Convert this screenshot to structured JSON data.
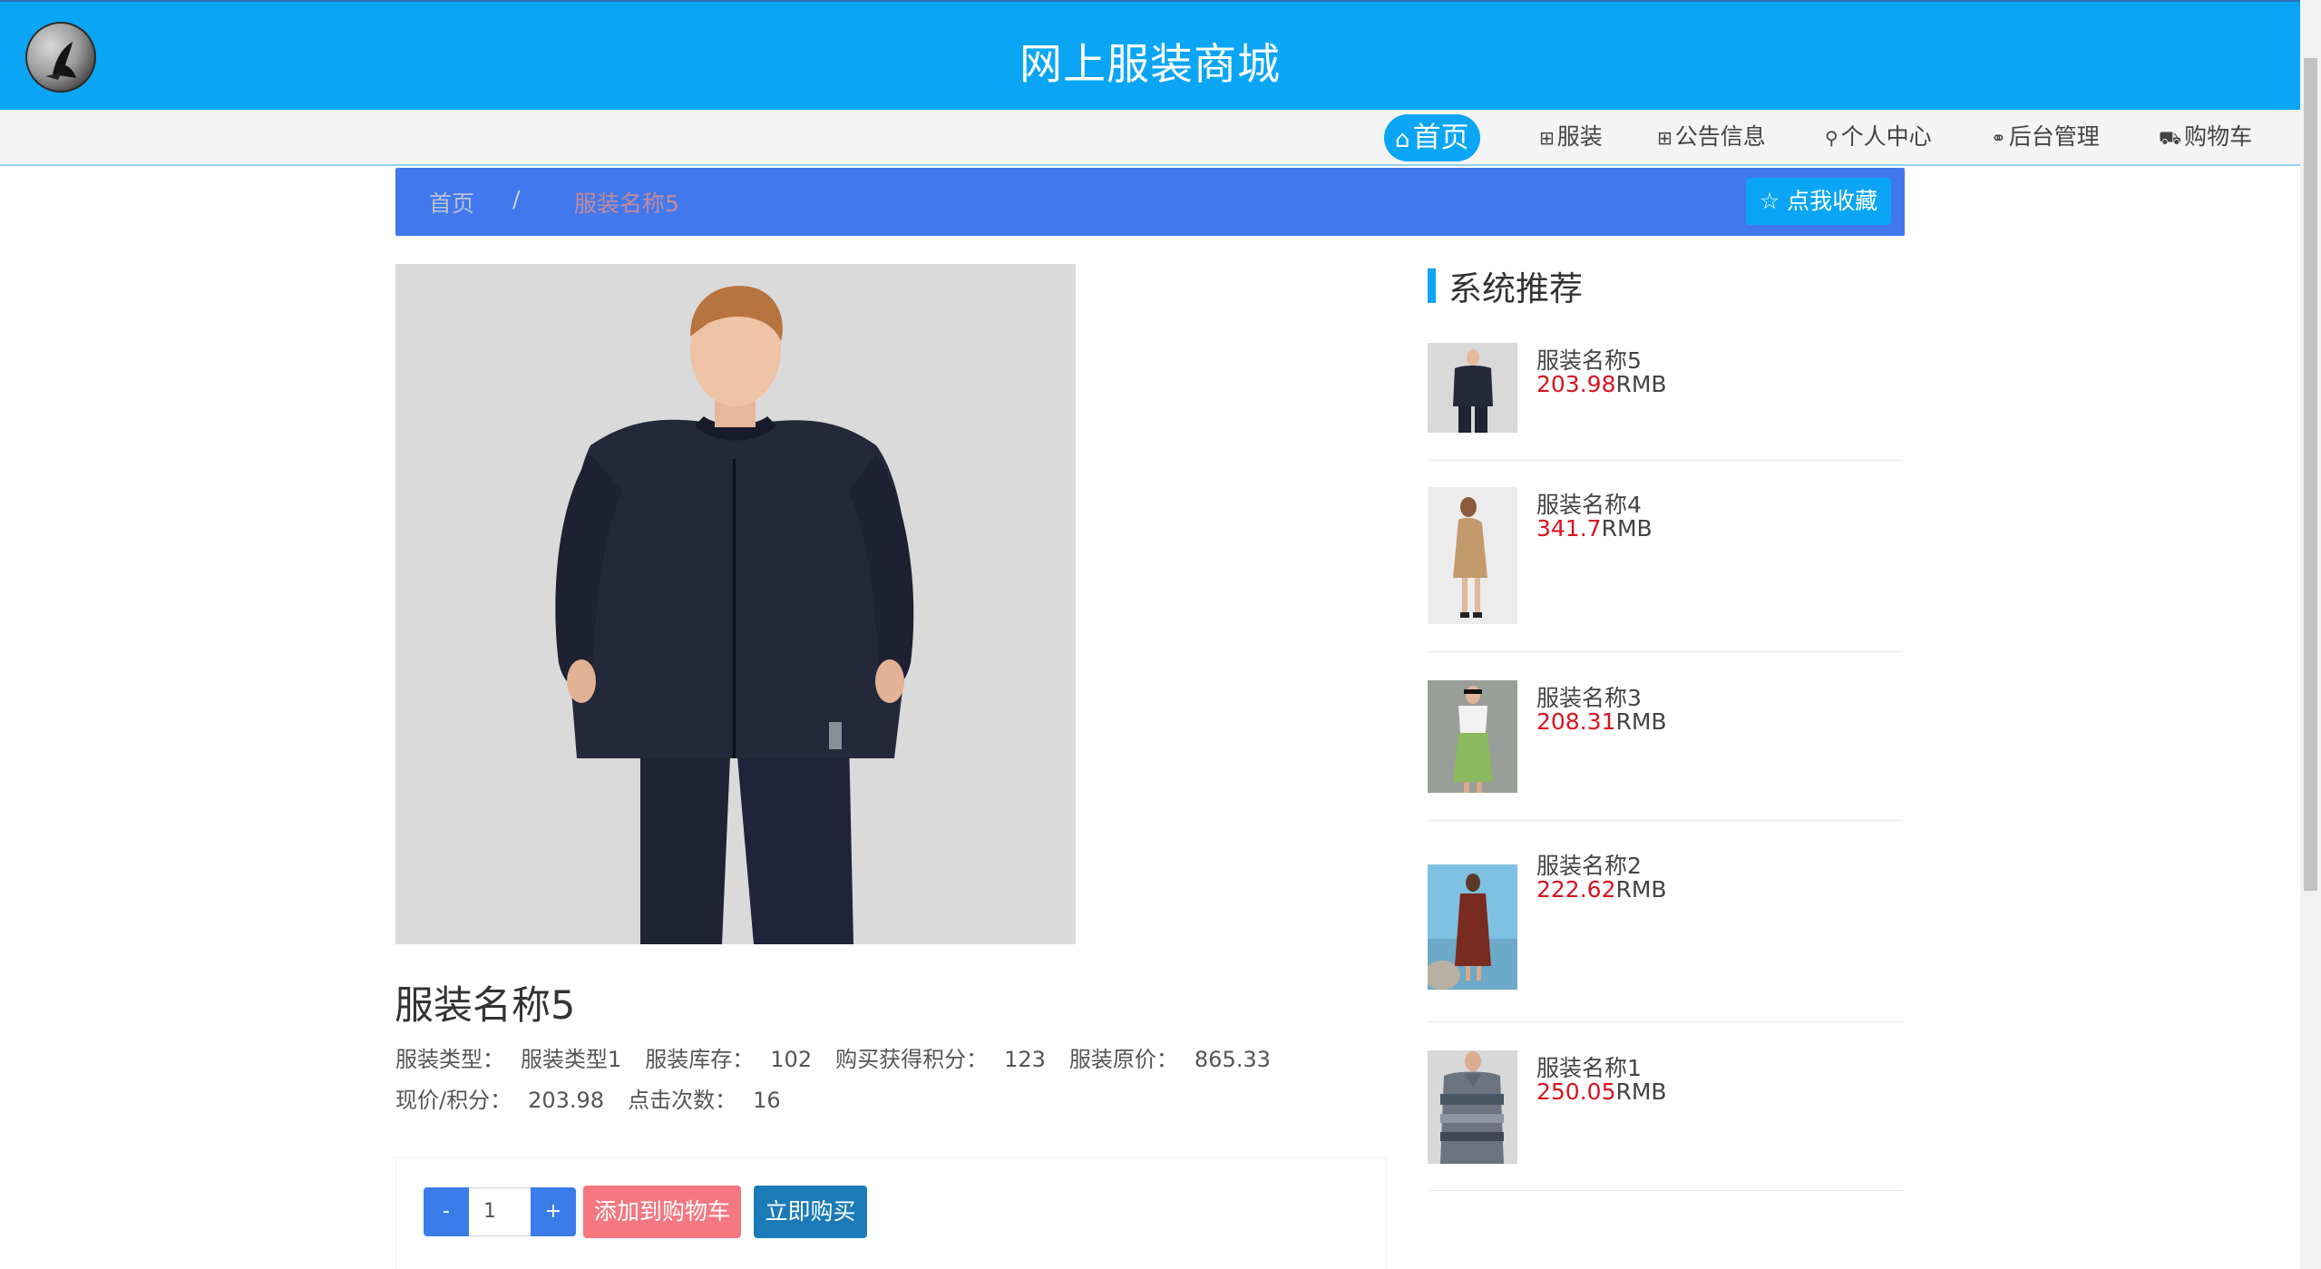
{
  "header": {
    "title": "网上服装商城",
    "logo": "logo-icon"
  },
  "nav": {
    "items": [
      {
        "label": "首页",
        "icon": "home-icon",
        "glyph": "⌂"
      },
      {
        "label": "服装",
        "icon": "gift-icon",
        "glyph": "⊞"
      },
      {
        "label": "公告信息",
        "icon": "grid-icon",
        "glyph": "⊞"
      },
      {
        "label": "个人中心",
        "icon": "user-icon",
        "glyph": "⚲"
      },
      {
        "label": "后台管理",
        "icon": "link-icon",
        "glyph": "⚭"
      },
      {
        "label": "购物车",
        "icon": "cart-icon",
        "glyph": "⛟"
      }
    ]
  },
  "breadcrumb": {
    "home": "首页",
    "sep": "/",
    "current": "服装名称5",
    "fav_label": "☆ 点我收藏"
  },
  "product": {
    "title": "服装名称5",
    "fields": {
      "type_label": "服装类型：",
      "type_value": "服装类型1",
      "stock_label": "服装库存：",
      "stock_value": "102",
      "points_label": "购买获得积分：",
      "points_value": "123",
      "orig_label": "服装原价：",
      "orig_value": "865.33",
      "price_label": "现价/积分：",
      "price_value": "203.98",
      "clicks_label": "点击次数：",
      "clicks_value": "16"
    },
    "qty": "1",
    "minus": "-",
    "plus": "+",
    "add_cart": "添加到购物车",
    "buy_now": "立即购买"
  },
  "recommend": {
    "heading": "系统推荐",
    "currency": "RMB",
    "items": [
      {
        "name": "服装名称5",
        "price": "203.98"
      },
      {
        "name": "服装名称4",
        "price": "341.7"
      },
      {
        "name": "服装名称3",
        "price": "208.31"
      },
      {
        "name": "服装名称2",
        "price": "222.62"
      },
      {
        "name": "服装名称1",
        "price": "250.05"
      }
    ]
  }
}
